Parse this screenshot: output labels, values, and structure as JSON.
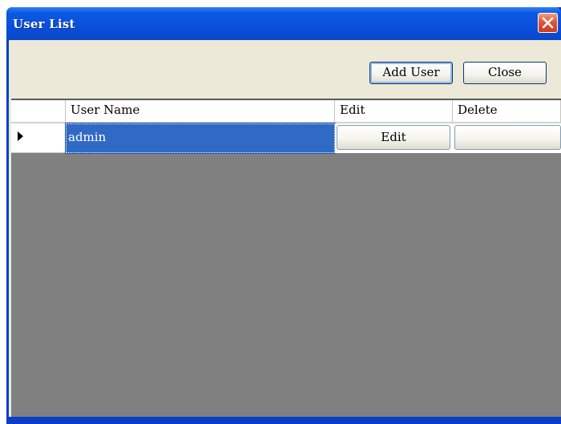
{
  "window": {
    "title": "User List",
    "close_icon": "close-icon"
  },
  "toolbar": {
    "add_user_label": "Add User",
    "close_label": "Close"
  },
  "grid": {
    "columns": [
      "User Name",
      "Edit",
      "Delete"
    ],
    "rows": [
      {
        "user_name": "admin",
        "edit_label": "Edit",
        "delete_label": "",
        "selected": true
      }
    ]
  },
  "colors": {
    "titlebar": "#0a4fd9",
    "selection": "#316ac5",
    "grid_background": "#808080",
    "client_background": "#ece9d8",
    "close_button": "#e2553a"
  }
}
